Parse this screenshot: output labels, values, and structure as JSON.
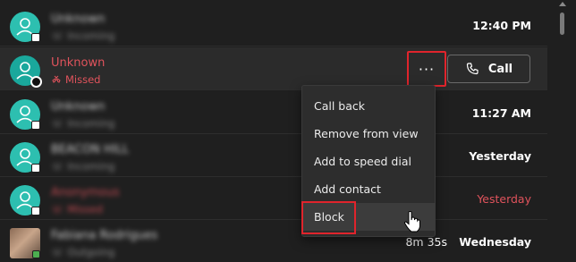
{
  "calls": [
    {
      "name": "Unknown",
      "sub": "Incoming",
      "time": "12:40 PM",
      "missed": false,
      "blurred": true
    },
    {
      "name": "Unknown",
      "sub": "Missed",
      "time": "",
      "missed": true,
      "blurred": false,
      "selected": true
    },
    {
      "name": "Unknown",
      "sub": "Incoming",
      "time": "11:27 AM",
      "missed": false,
      "blurred": true
    },
    {
      "name": "BEACON HILL",
      "sub": "Incoming",
      "time": "Yesterday",
      "missed": false,
      "blurred": true
    },
    {
      "name": "Anonymous",
      "sub": "Missed",
      "time": "Yesterday",
      "missed": true,
      "blurred": true
    },
    {
      "name": "Fabiana Rodrigues",
      "sub": "Outgoing",
      "time": "Wednesday",
      "duration": "8m 35s",
      "missed": false,
      "blurred": true
    }
  ],
  "actions": {
    "more_label": "···",
    "call_label": "Call"
  },
  "menu": {
    "items": [
      "Call back",
      "Remove from view",
      "Add to speed dial",
      "Add contact",
      "Block"
    ]
  },
  "colors": {
    "missed": "#e0535c",
    "avatar": "#2dbfb0",
    "highlight": "#e0242c"
  }
}
